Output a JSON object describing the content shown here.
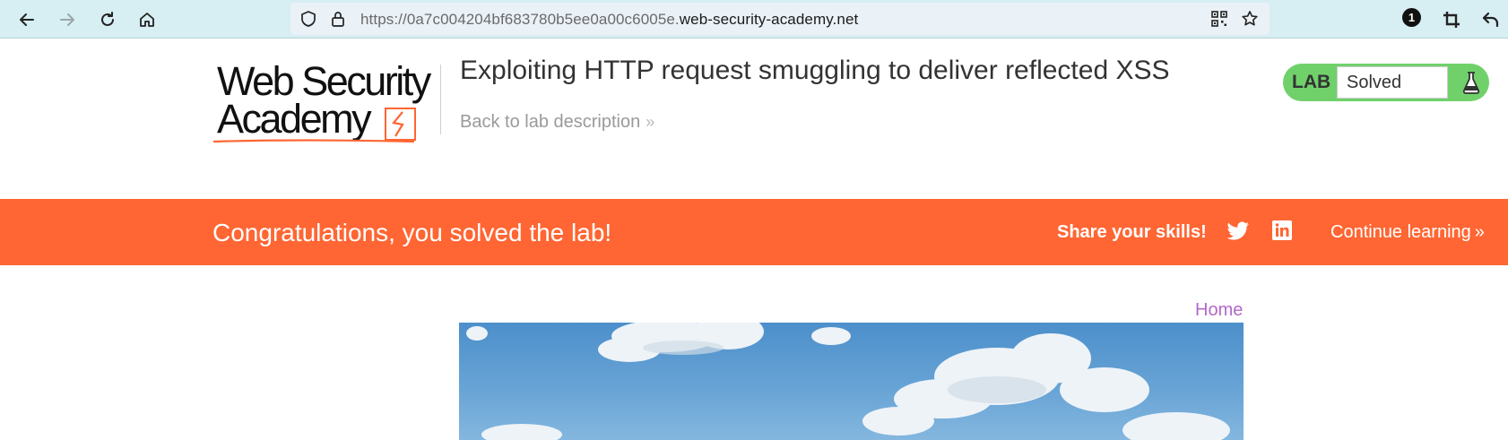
{
  "browser": {
    "url_prefix": "https://0a7c004204bf683780b5ee0a00c6005e.",
    "url_domain": "web-security-academy.net",
    "extension_badge": "1",
    "icons": [
      "back-arrow-icon",
      "forward-arrow-icon",
      "reload-icon",
      "home-icon",
      "shield-icon",
      "lock-icon",
      "qr-code-icon",
      "star-icon",
      "crop-icon",
      "undo-icon"
    ]
  },
  "header": {
    "logo_line1": "Web Security",
    "logo_line2": "Academy",
    "lab_title": "Exploiting HTTP request smuggling to deliver reflected XSS",
    "back_link": "Back to lab description",
    "back_chevrons": "»",
    "lab_status_label": "LAB",
    "lab_status_value": "Solved"
  },
  "banner": {
    "congrats": "Congratulations, you solved the lab!",
    "share": "Share your skills!",
    "continue": "Continue learning",
    "continue_chevrons": "»"
  },
  "page": {
    "home_link": "Home"
  },
  "colors": {
    "banner": "#ff6633",
    "lab_status": "#70d16b",
    "home_link": "#b468c8",
    "toolbar": "#d7eef2"
  }
}
